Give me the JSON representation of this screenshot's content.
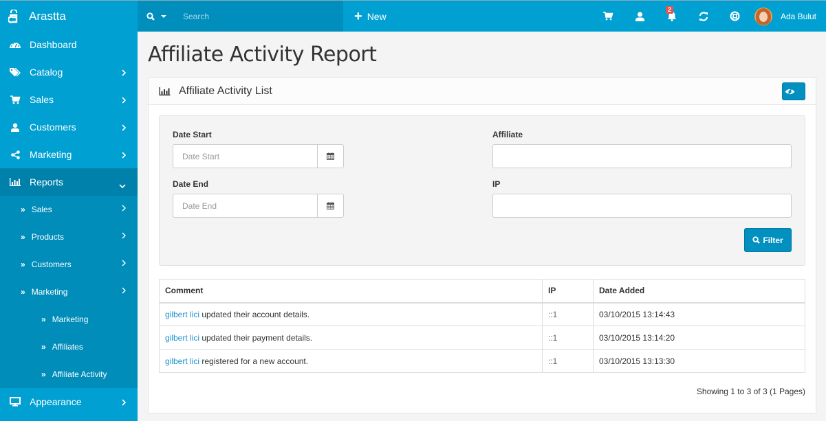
{
  "app": {
    "brand": "Arastta",
    "accent_color": "#00a0d2"
  },
  "topbar": {
    "search_placeholder": "Search",
    "new_label": "New",
    "notification_count": "2",
    "icons": [
      "cart-icon",
      "user-icon",
      "bell-icon",
      "refresh-icon",
      "support-icon"
    ],
    "user_name": "Ada Bulut"
  },
  "sidebar": {
    "items": [
      {
        "label": "Dashboard",
        "icon": "dashboard-icon"
      },
      {
        "label": "Catalog",
        "icon": "tags-icon"
      },
      {
        "label": "Sales",
        "icon": "cart-icon"
      },
      {
        "label": "Customers",
        "icon": "user-icon"
      },
      {
        "label": "Marketing",
        "icon": "share-icon"
      },
      {
        "label": "Reports",
        "icon": "bar-chart-icon"
      },
      {
        "label": "Appearance",
        "icon": "desktop-icon"
      }
    ],
    "reports_sub": [
      {
        "label": "Sales"
      },
      {
        "label": "Products"
      },
      {
        "label": "Customers"
      },
      {
        "label": "Marketing"
      }
    ],
    "marketing_sub": [
      {
        "label": "Marketing"
      },
      {
        "label": "Affiliates"
      },
      {
        "label": "Affiliate Activity"
      }
    ]
  },
  "page": {
    "title": "Affiliate Activity Report",
    "panel_title": "Affiliate Activity List"
  },
  "filter": {
    "date_start_label": "Date Start",
    "date_start_placeholder": "Date Start",
    "date_start_value": "",
    "date_end_label": "Date End",
    "date_end_placeholder": "Date End",
    "date_end_value": "",
    "affiliate_label": "Affiliate",
    "affiliate_value": "",
    "ip_label": "IP",
    "ip_value": "",
    "button_label": "Filter"
  },
  "table": {
    "headers": [
      "Comment",
      "IP",
      "Date Added"
    ],
    "rows": [
      {
        "name": "gilbert lici",
        "comment": " updated their account details.",
        "ip": "::1",
        "date": "03/10/2015 13:14:43"
      },
      {
        "name": "gilbert lici",
        "comment": " updated their payment details.",
        "ip": "::1",
        "date": "03/10/2015 13:14:20"
      },
      {
        "name": "gilbert lici",
        "comment": " registered for a new account.",
        "ip": "::1",
        "date": "03/10/2015 13:13:30"
      }
    ],
    "pagination": "Showing 1 to 3 of 3 (1 Pages)"
  }
}
